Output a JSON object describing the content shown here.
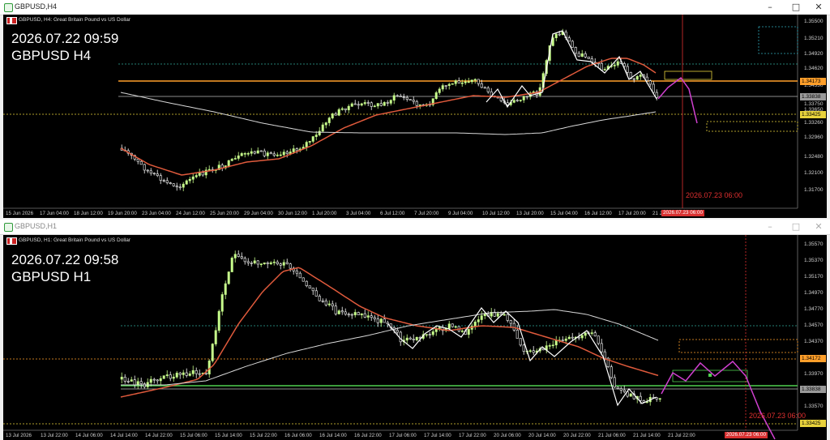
{
  "top": {
    "window_title": "GBPUSD,H4",
    "symbol_desc": "GBPUSD, H4:  Great Britain Pound vs US Dollar",
    "overlay_datetime": "2026.07.22 09:59",
    "overlay_symbol": "GBPUSD H4",
    "price_axis": [
      "1.35500",
      "1.35210",
      "1.34920",
      "1.34620",
      "1.34330",
      "1.34040",
      "1.33750",
      "1.33650",
      "1.33260",
      "1.32960",
      "1.32480",
      "1.32100",
      "1.31700"
    ],
    "price_labels": {
      "orange": "1.34173",
      "gray": "1.33838",
      "yellow": "1.33425"
    },
    "time_axis": [
      "15 Jun 2026",
      "17 Jun 04:00",
      "18 Jun 12:00",
      "19 Jun 20:00",
      "23 Jun 04:00",
      "24 Jun 12:00",
      "25 Jun 20:00",
      "29 Jun 04:00",
      "30 Jun 12:00",
      "1 Jul 20:00",
      "3 Jul 04:00",
      "6 Jul 12:00",
      "7 Jul 20:00",
      "9 Jul 04:00",
      "10 Jul 12:00",
      "13 Jul 20:00",
      "15 Jul 04:00",
      "16 Jul 12:00",
      "17 Jul 20:00",
      "21 Jul 04:00"
    ],
    "vline_label": "2026.07.23 06:00",
    "vline_box": "2026.07.23 06:00"
  },
  "bottom": {
    "window_title": "GBPUSD,H1",
    "symbol_desc": "GBPUSD, H1:  Great Britain Pound vs US Dollar",
    "overlay_datetime": "2026.07.22 09:58",
    "overlay_symbol": "GBPUSD H1",
    "price_axis": [
      "1.35570",
      "1.35370",
      "1.35170",
      "1.34970",
      "1.34770",
      "1.34570",
      "1.34370",
      "1.34170",
      "1.33970",
      "1.33770",
      "1.33570"
    ],
    "price_labels": {
      "orange": "1.34172",
      "gray": "1.33838",
      "yellow": "1.33425"
    },
    "time_axis": [
      "13 Jul 2026",
      "13 Jul 22:00",
      "14 Jul 06:00",
      "14 Jul 14:00",
      "14 Jul 22:00",
      "15 Jul 06:00",
      "15 Jul 14:00",
      "15 Jul 22:00",
      "16 Jul 06:00",
      "16 Jul 14:00",
      "16 Jul 22:00",
      "17 Jul 06:00",
      "17 Jul 14:00",
      "17 Jul 22:00",
      "20 Jul 06:00",
      "20 Jul 14:00",
      "20 Jul 22:00",
      "21 Jul 06:00",
      "21 Jul 14:00",
      "21 Jul 22:00"
    ],
    "vline_label": "2026.07.23 06:00",
    "vline_box": "2026.07.23 06:00"
  },
  "colors": {
    "bull": "#c8ff8c",
    "bear": "#ffffff",
    "ma_red": "#e05a3c",
    "ma_white": "#d8d8d8",
    "orange": "#ff9f2a",
    "yellow": "#e8d23c",
    "green": "#4fcf4f",
    "magenta": "#d040d0",
    "vline": "#e03030"
  }
}
